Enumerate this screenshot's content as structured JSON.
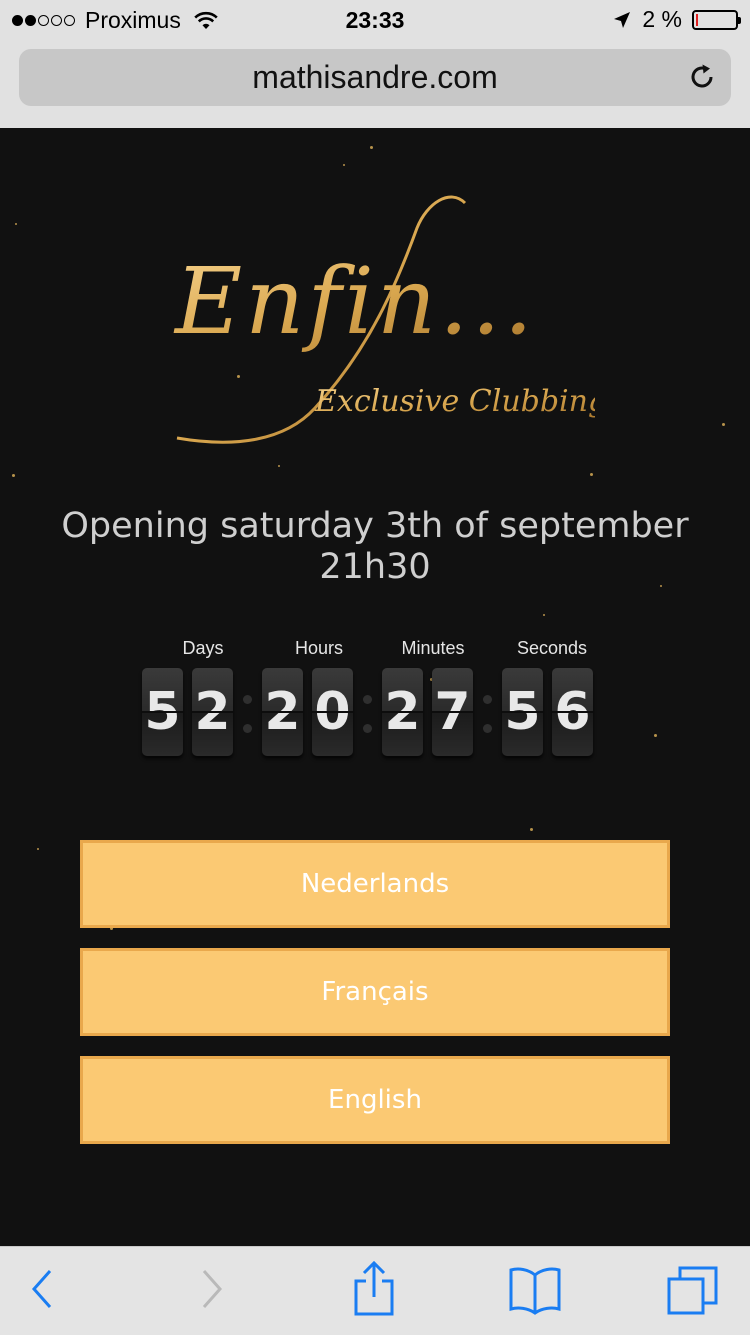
{
  "status_bar": {
    "carrier": "Proximus",
    "time": "23:33",
    "battery_text": "2 %",
    "signal_bars_filled": 2,
    "signal_bars_total": 5,
    "battery_level": 0.02
  },
  "browser": {
    "url": "mathisandre.com"
  },
  "logo": {
    "title": "Enfin...",
    "subtitle": "Exclusive Clubbing"
  },
  "event": {
    "opening_line1": "Opening saturday 3th of september",
    "opening_line2": "21h30"
  },
  "countdown": {
    "labels": {
      "days": "Days",
      "hours": "Hours",
      "minutes": "Minutes",
      "seconds": "Seconds"
    },
    "digits": [
      "5",
      "2",
      "2",
      "0",
      "2",
      "7",
      "5",
      "6"
    ]
  },
  "languages": [
    "Nederlands",
    "Français",
    "English"
  ],
  "colors": {
    "background": "#111111",
    "button_fill": "#fbc973",
    "button_border": "#e9a84c",
    "logo_gold": "#d9a74f",
    "ios_blue": "#1a7df2"
  },
  "toolbar": {
    "icons": [
      "back-icon",
      "forward-icon",
      "share-icon",
      "bookmarks-icon",
      "tabs-icon"
    ]
  }
}
